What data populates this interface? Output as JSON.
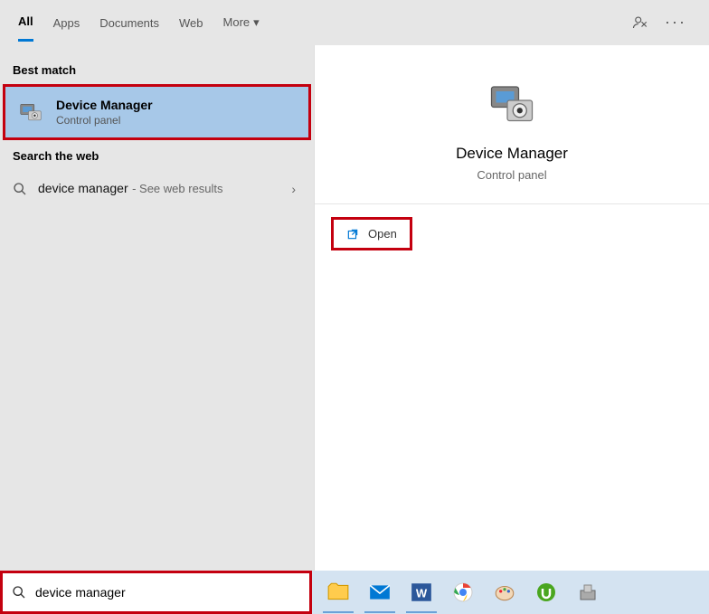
{
  "tabs": {
    "all": "All",
    "apps": "Apps",
    "documents": "Documents",
    "web": "Web",
    "more": "More"
  },
  "sections": {
    "best_match": "Best match",
    "search_web": "Search the web"
  },
  "result": {
    "title": "Device Manager",
    "subtitle": "Control panel"
  },
  "web_result": {
    "query": "device manager",
    "suffix": "See web results"
  },
  "preview": {
    "title": "Device Manager",
    "subtitle": "Control panel"
  },
  "actions": {
    "open": "Open"
  },
  "search": {
    "value": "device manager"
  },
  "taskbar": {
    "items": [
      "file-explorer",
      "mail",
      "word",
      "chrome",
      "paint",
      "utorrent",
      "installer"
    ]
  },
  "colors": {
    "annotation": "#c4000f",
    "accent": "#0078d4",
    "selected": "#a7c8e8"
  }
}
